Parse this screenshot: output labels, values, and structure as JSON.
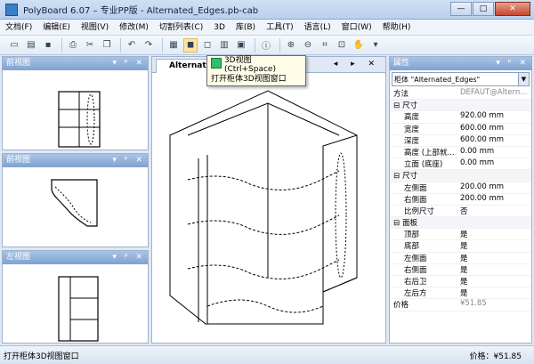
{
  "window": {
    "title": "PolyBoard 6.07 – 专业PP版 - Alternated_Edges.pb-cab",
    "minimize": "—",
    "maximize": "□",
    "close": "✕"
  },
  "menu": [
    "文档(F)",
    "编辑(E)",
    "视图(V)",
    "修改(M)",
    "切割列表(C)",
    "3D",
    "库(B)",
    "工具(T)",
    "语言(L)",
    "窗口(W)",
    "帮助(H)"
  ],
  "panels": {
    "top": {
      "title": "前视图"
    },
    "middle": {
      "title": "前视图"
    },
    "left": {
      "title": "左视图"
    },
    "controls": "▾ ᵖ ✕"
  },
  "document": {
    "tab_label": "Alternated_Edges",
    "tab_controls": "◂ ▸ ✕"
  },
  "tooltip": {
    "shortcut": "3D视图 (Ctrl+Space)",
    "description": "打开柜体3D视图窗口"
  },
  "properties": {
    "title": "属性",
    "cabinet_label": "柜体",
    "cabinet_name": "\"Alternated_Edges\"",
    "rows": [
      {
        "k": "方法",
        "v": "DEFAUT@Altern...",
        "type": "plain",
        "muted": true
      },
      {
        "k": "尺寸",
        "v": "",
        "type": "group",
        "sign": "⊟"
      },
      {
        "k": "高度",
        "v": "920.00 mm",
        "type": "indent"
      },
      {
        "k": "宽度",
        "v": "600.00 mm",
        "type": "indent"
      },
      {
        "k": "深度",
        "v": "600.00 mm",
        "type": "indent"
      },
      {
        "k": "高度 (上部就...",
        "v": "0.00 mm",
        "type": "indent"
      },
      {
        "k": "立面 (底座)",
        "v": "0.00 mm",
        "type": "indent"
      },
      {
        "k": "尺寸",
        "v": "",
        "type": "group",
        "sign": "⊟"
      },
      {
        "k": "左侧面",
        "v": "200.00 mm",
        "type": "indent"
      },
      {
        "k": "右侧面",
        "v": "200.00 mm",
        "type": "indent"
      },
      {
        "k": "比例尺寸",
        "v": "否",
        "type": "indent"
      },
      {
        "k": "面板",
        "v": "",
        "type": "group",
        "sign": "⊟"
      },
      {
        "k": "顶部",
        "v": "是",
        "type": "indent"
      },
      {
        "k": "底部",
        "v": "是",
        "type": "indent"
      },
      {
        "k": "左侧面",
        "v": "是",
        "type": "indent"
      },
      {
        "k": "右侧面",
        "v": "是",
        "type": "indent"
      },
      {
        "k": "右后卫",
        "v": "是",
        "type": "indent"
      },
      {
        "k": "左后方",
        "v": "是",
        "type": "indent"
      },
      {
        "k": "价格",
        "v": "¥51.85",
        "type": "plain",
        "muted": true
      }
    ]
  },
  "status": {
    "left": "打开柜体3D视图窗口",
    "right": "价格：¥51.85"
  },
  "colors": {
    "accent": "#7fa2d1",
    "tooltip_cube": "#2fbf6b",
    "active_tool": "#fbe6a8"
  }
}
